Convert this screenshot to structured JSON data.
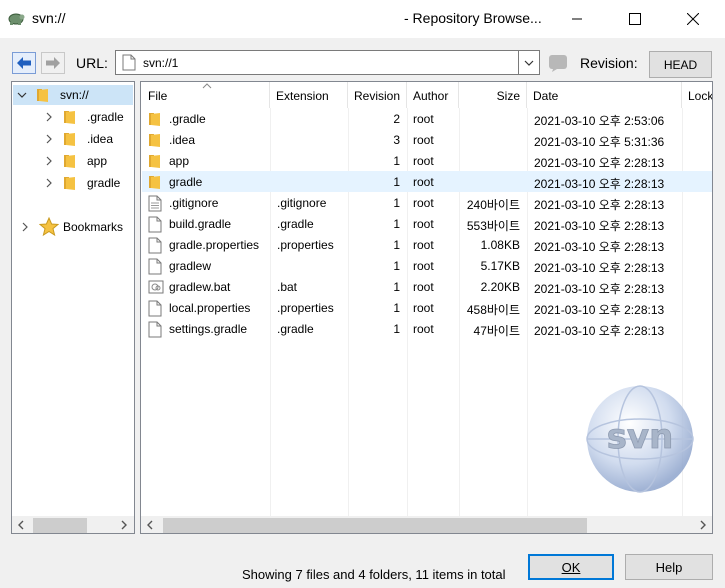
{
  "window": {
    "title_left": "svn://",
    "title_right": "- Repository Browse...",
    "minimize_glyph": "—",
    "maximize_glyph": "☐",
    "close_glyph": "✕"
  },
  "toolbar": {
    "url_label": "URL:",
    "url_value": "svn://1",
    "revision_label": "Revision:",
    "head_button": "HEAD"
  },
  "tree": {
    "root": "svn://",
    "children": [
      ".gradle",
      ".idea",
      "app",
      "gradle"
    ],
    "bookmarks": "Bookmarks"
  },
  "list": {
    "columns": {
      "file": "File",
      "extension": "Extension",
      "revision": "Revision",
      "author": "Author",
      "size": "Size",
      "date": "Date",
      "lock": "Lock"
    },
    "rows": [
      {
        "name": ".gradle",
        "ext": "",
        "rev": "2",
        "author": "root",
        "size": "",
        "date": "2021-03-10 오후 2:53:06",
        "icon": "folder-icon"
      },
      {
        "name": ".idea",
        "ext": "",
        "rev": "3",
        "author": "root",
        "size": "",
        "date": "2021-03-10 오후 5:31:36",
        "icon": "folder-icon"
      },
      {
        "name": "app",
        "ext": "",
        "rev": "1",
        "author": "root",
        "size": "",
        "date": "2021-03-10 오후 2:28:13",
        "icon": "folder-icon"
      },
      {
        "name": "gradle",
        "ext": "",
        "rev": "1",
        "author": "root",
        "size": "",
        "date": "2021-03-10 오후 2:28:13",
        "icon": "folder-icon"
      },
      {
        "name": ".gitignore",
        "ext": ".gitignore",
        "rev": "1",
        "author": "root",
        "size": "240바이트",
        "date": "2021-03-10 오후 2:28:13",
        "icon": "text-file-icon"
      },
      {
        "name": "build.gradle",
        "ext": ".gradle",
        "rev": "1",
        "author": "root",
        "size": "553바이트",
        "date": "2021-03-10 오후 2:28:13",
        "icon": "file-icon"
      },
      {
        "name": "gradle.properties",
        "ext": ".properties",
        "rev": "1",
        "author": "root",
        "size": "1.08KB",
        "date": "2021-03-10 오후 2:28:13",
        "icon": "file-icon"
      },
      {
        "name": "gradlew",
        "ext": "",
        "rev": "1",
        "author": "root",
        "size": "5.17KB",
        "date": "2021-03-10 오후 2:28:13",
        "icon": "file-icon"
      },
      {
        "name": "gradlew.bat",
        "ext": ".bat",
        "rev": "1",
        "author": "root",
        "size": "2.20KB",
        "date": "2021-03-10 오후 2:28:13",
        "icon": "batch-file-icon"
      },
      {
        "name": "local.properties",
        "ext": ".properties",
        "rev": "1",
        "author": "root",
        "size": "458바이트",
        "date": "2021-03-10 오후 2:28:13",
        "icon": "file-icon"
      },
      {
        "name": "settings.gradle",
        "ext": ".gradle",
        "rev": "1",
        "author": "root",
        "size": "47바이트",
        "date": "2021-03-10 오후 2:28:13",
        "icon": "file-icon"
      }
    ],
    "selected_index": 3
  },
  "watermark_text": "svn",
  "status": "Showing 7 files and 4 folders, 11 items in total",
  "buttons": {
    "ok": "OK",
    "help": "Help"
  },
  "colors": {
    "selection": "#cce4f7",
    "row_hover": "#e5f3ff",
    "folder": "#f5c242",
    "accent": "#0078d7"
  }
}
